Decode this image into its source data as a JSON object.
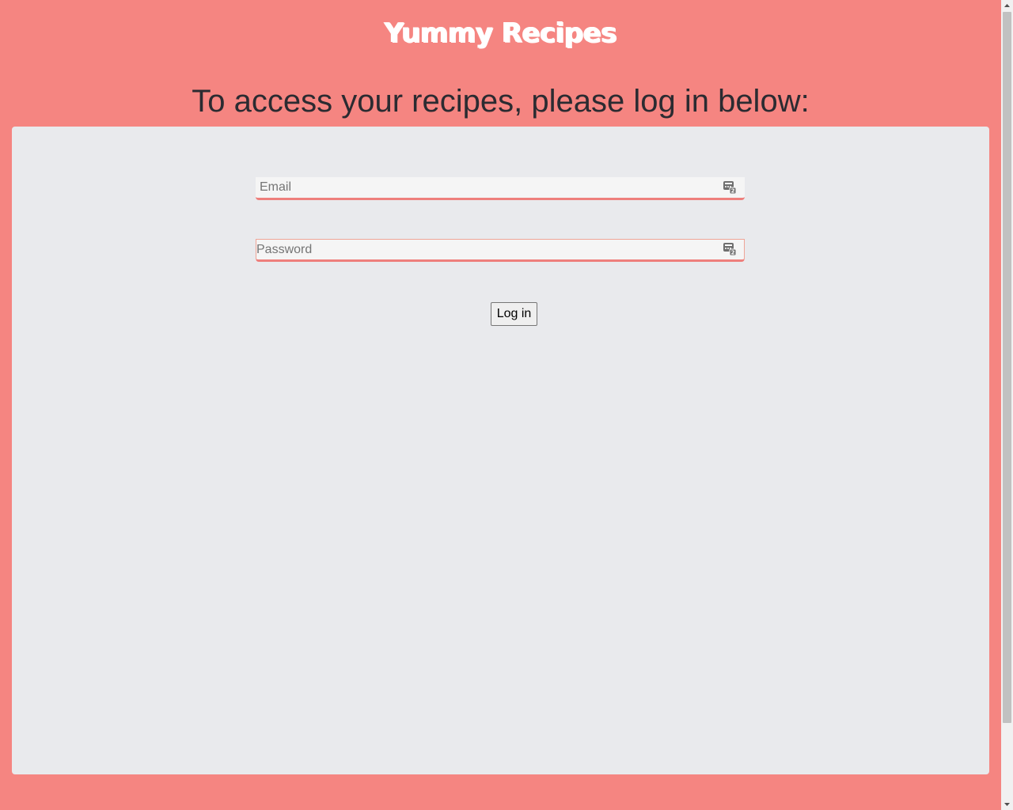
{
  "header": {
    "site_title": "Yummy Recipes",
    "heading": "To access your recipes, please log in below:"
  },
  "login_form": {
    "email": {
      "placeholder": "Email",
      "value": "",
      "icon": "password-manager-icon"
    },
    "password": {
      "placeholder": "Password",
      "value": "",
      "icon": "password-manager-icon",
      "focused": true
    },
    "submit_label": "Log in"
  },
  "colors": {
    "page_background": "#f58581",
    "panel_background": "#e9eaed",
    "field_accent": "#ee7f7c",
    "title_color": "#ffffff",
    "heading_color": "#2b2b31"
  }
}
